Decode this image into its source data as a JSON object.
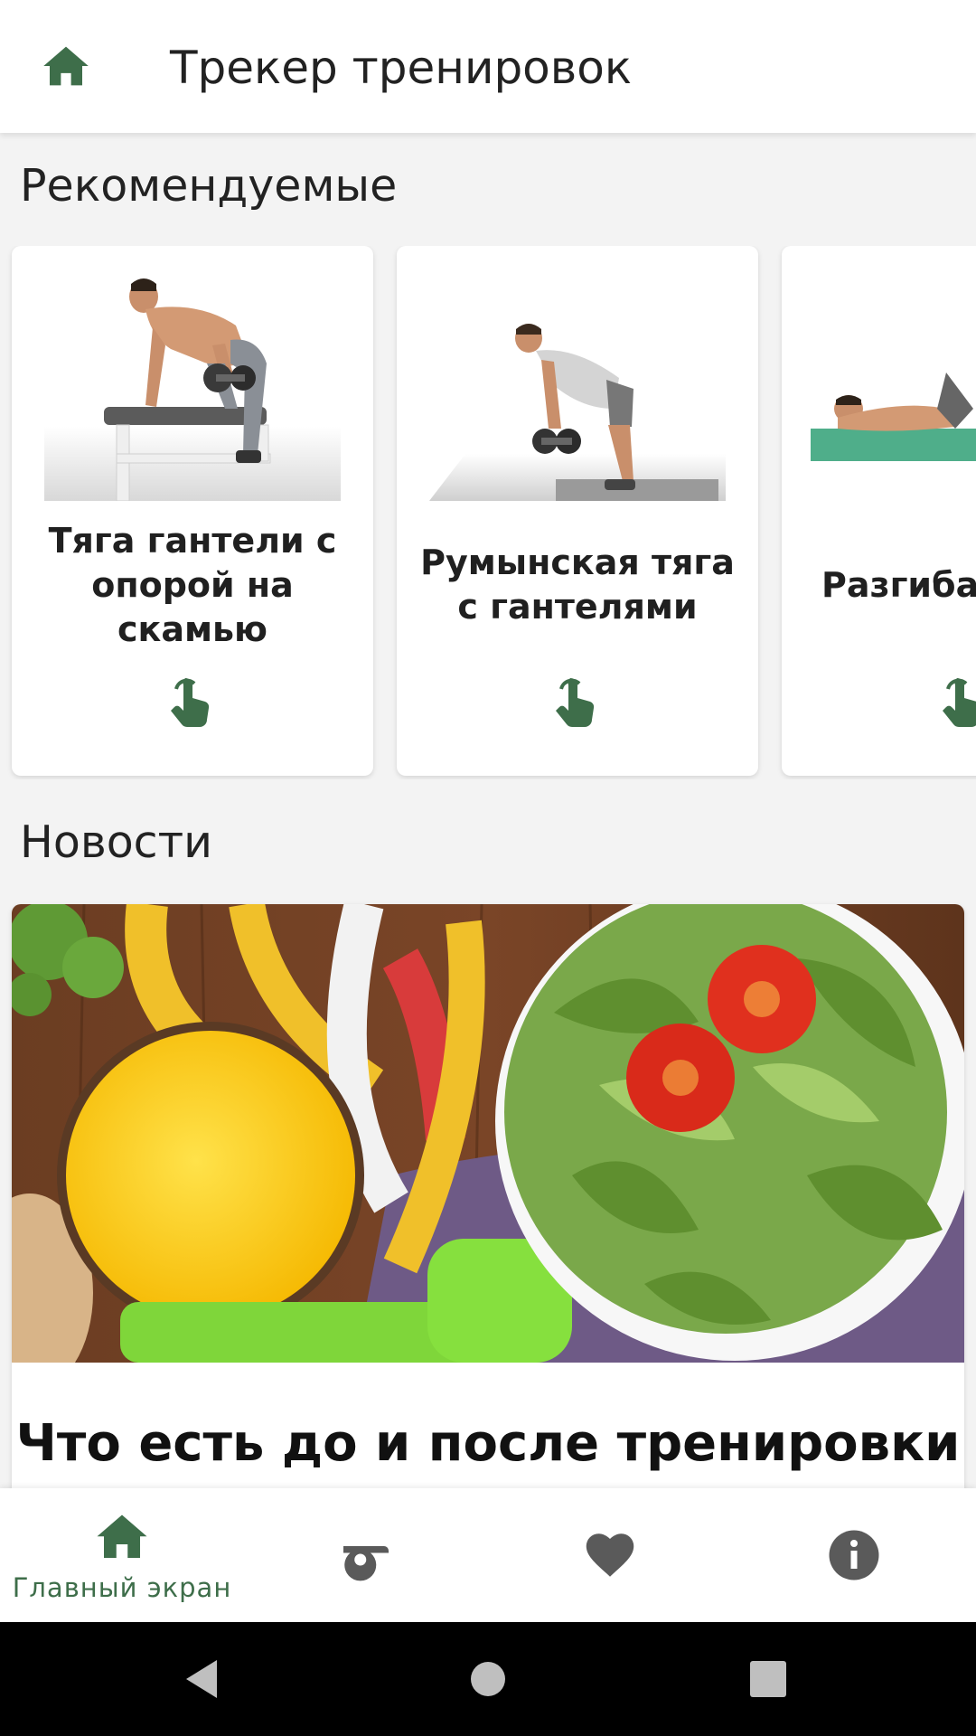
{
  "app_bar": {
    "title": "Трекер тренировок",
    "home_icon": "home-icon"
  },
  "recommended": {
    "title": "Рекомендуемые",
    "cards": [
      {
        "name": "Тяга гантели с опорой на скамью",
        "image": "dumbbell-row-bench-illustration",
        "action_icon": "tap-icon"
      },
      {
        "name": "Румынская тяга с гантелями",
        "image": "romanian-deadlift-illustration",
        "action_icon": "tap-icon"
      },
      {
        "name": "Разгибан лежа",
        "image": "lying-exercise-illustration",
        "action_icon": "tap-icon"
      }
    ]
  },
  "news": {
    "title": "Новости",
    "items": [
      {
        "headline": "Что есть до и после тренировки",
        "image": "healthy-food-photo"
      }
    ]
  },
  "bottom_nav": {
    "items": [
      {
        "label": "Главный экран",
        "icon": "home-icon",
        "active": true
      },
      {
        "label": "",
        "icon": "whistle-icon",
        "active": false
      },
      {
        "label": "",
        "icon": "heart-icon",
        "active": false
      },
      {
        "label": "",
        "icon": "info-icon",
        "active": false
      }
    ]
  },
  "system_nav": {
    "buttons": [
      "back-icon",
      "home-circle-icon",
      "recents-icon"
    ]
  },
  "colors": {
    "accent": "#3e6e4a",
    "icon_gray": "#5a5a5a",
    "background": "#f3f3f3",
    "card": "#ffffff"
  }
}
